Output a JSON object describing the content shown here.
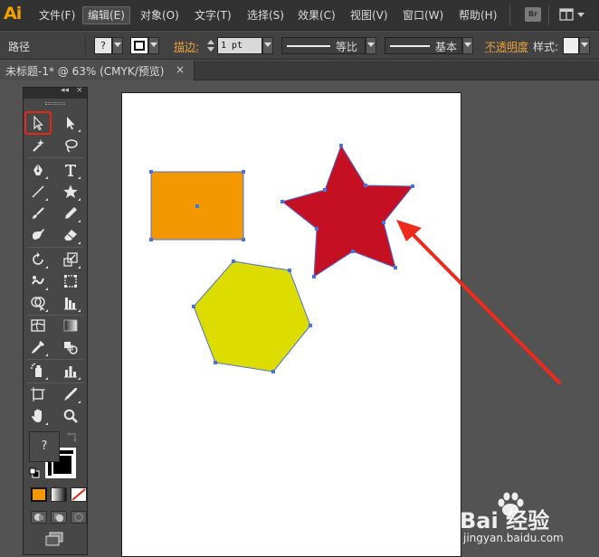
{
  "app": {
    "logo": "Ai",
    "bridge_label": "Br"
  },
  "menu": {
    "items": [
      {
        "label": "文件(F)"
      },
      {
        "label": "编辑(E)"
      },
      {
        "label": "对象(O)"
      },
      {
        "label": "文字(T)"
      },
      {
        "label": "选择(S)"
      },
      {
        "label": "效果(C)"
      },
      {
        "label": "视图(V)"
      },
      {
        "label": "窗口(W)"
      },
      {
        "label": "帮助(H)"
      }
    ],
    "active_index": 1
  },
  "control_bar": {
    "selection_label": "路径",
    "fill_value": "?",
    "stroke_link": "描边:",
    "stroke_weight": "1 pt",
    "profile_label": "等比",
    "brush_label": "基本",
    "opacity_link": "不透明度",
    "style_label": "样式:"
  },
  "document": {
    "tab_title": "未标题-1* @ 63% (CMYK/预览)",
    "close_glyph": "×"
  },
  "toolbox": {
    "collapse_glyph": "◂◂",
    "close_glyph": "×",
    "fill_value": "?",
    "tools": [
      "selection-tool",
      "direct-selection-tool",
      "magic-wand-tool",
      "lasso-tool",
      "pen-tool",
      "type-tool",
      "line-segment-tool",
      "star-tool",
      "paintbrush-tool",
      "pencil-tool",
      "blob-brush-tool",
      "eraser-tool",
      "rotate-tool",
      "scale-tool",
      "warp-tool",
      "free-transform-tool",
      "shape-builder-tool",
      "graph-tool",
      "mesh-tool",
      "gradient-tool",
      "eyedropper-tool",
      "blend-tool",
      "symbol-sprayer-tool",
      "column-graph-tool",
      "artboard-tool",
      "slice-tool",
      "hand-tool",
      "zoom-tool"
    ],
    "selected_tool": "selection-tool"
  },
  "artwork": {
    "rectangle_fill": "#f39800",
    "star_fill": "#c50f23",
    "hexagon_fill": "#dcdc00",
    "selection_color": "#4a72d8",
    "arrow_color": "#ee2a1c"
  },
  "watermark": {
    "text": "Bai 经验",
    "sub": "jingyan.baidu.com"
  }
}
